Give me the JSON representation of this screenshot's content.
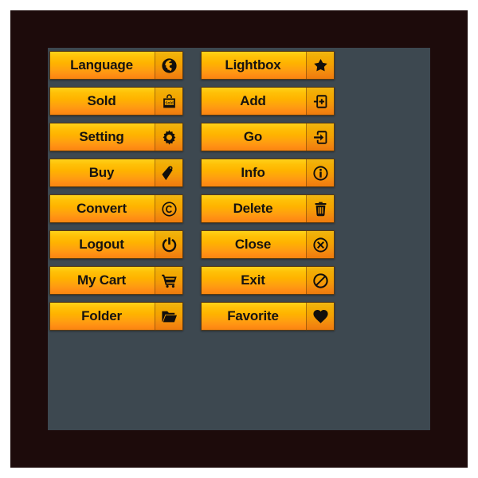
{
  "theme": {
    "page_background": "#ffffff",
    "frame_color": "#1d0b0b",
    "panel_color": "#3d4850",
    "button_gradient_top": "#ffd21a",
    "button_gradient_bottom": "#f9860f",
    "button_border": "#5a3a12",
    "label_color": "#161310",
    "icon_color": "#120f0c"
  },
  "buttons": {
    "left_column": [
      {
        "label": "Language",
        "icon": "globe-icon"
      },
      {
        "label": "Sold",
        "icon": "sold-bag-icon"
      },
      {
        "label": "Setting",
        "icon": "gear-icon"
      },
      {
        "label": "Buy",
        "icon": "price-tag-icon"
      },
      {
        "label": "Convert",
        "icon": "copyright-icon"
      },
      {
        "label": "Logout",
        "icon": "power-icon"
      },
      {
        "label": "My Cart",
        "icon": "shopping-cart-icon"
      },
      {
        "label": "Folder",
        "icon": "open-folder-icon"
      }
    ],
    "right_column": [
      {
        "label": "Lightbox",
        "icon": "star-icon"
      },
      {
        "label": "Add",
        "icon": "plus-box-icon"
      },
      {
        "label": "Go",
        "icon": "arrow-into-box-icon"
      },
      {
        "label": "Info",
        "icon": "info-circle-icon"
      },
      {
        "label": "Delete",
        "icon": "trash-can-icon"
      },
      {
        "label": "Close",
        "icon": "x-circle-icon"
      },
      {
        "label": "Exit",
        "icon": "no-entry-icon"
      },
      {
        "label": "Favorite",
        "icon": "heart-icon"
      }
    ]
  }
}
